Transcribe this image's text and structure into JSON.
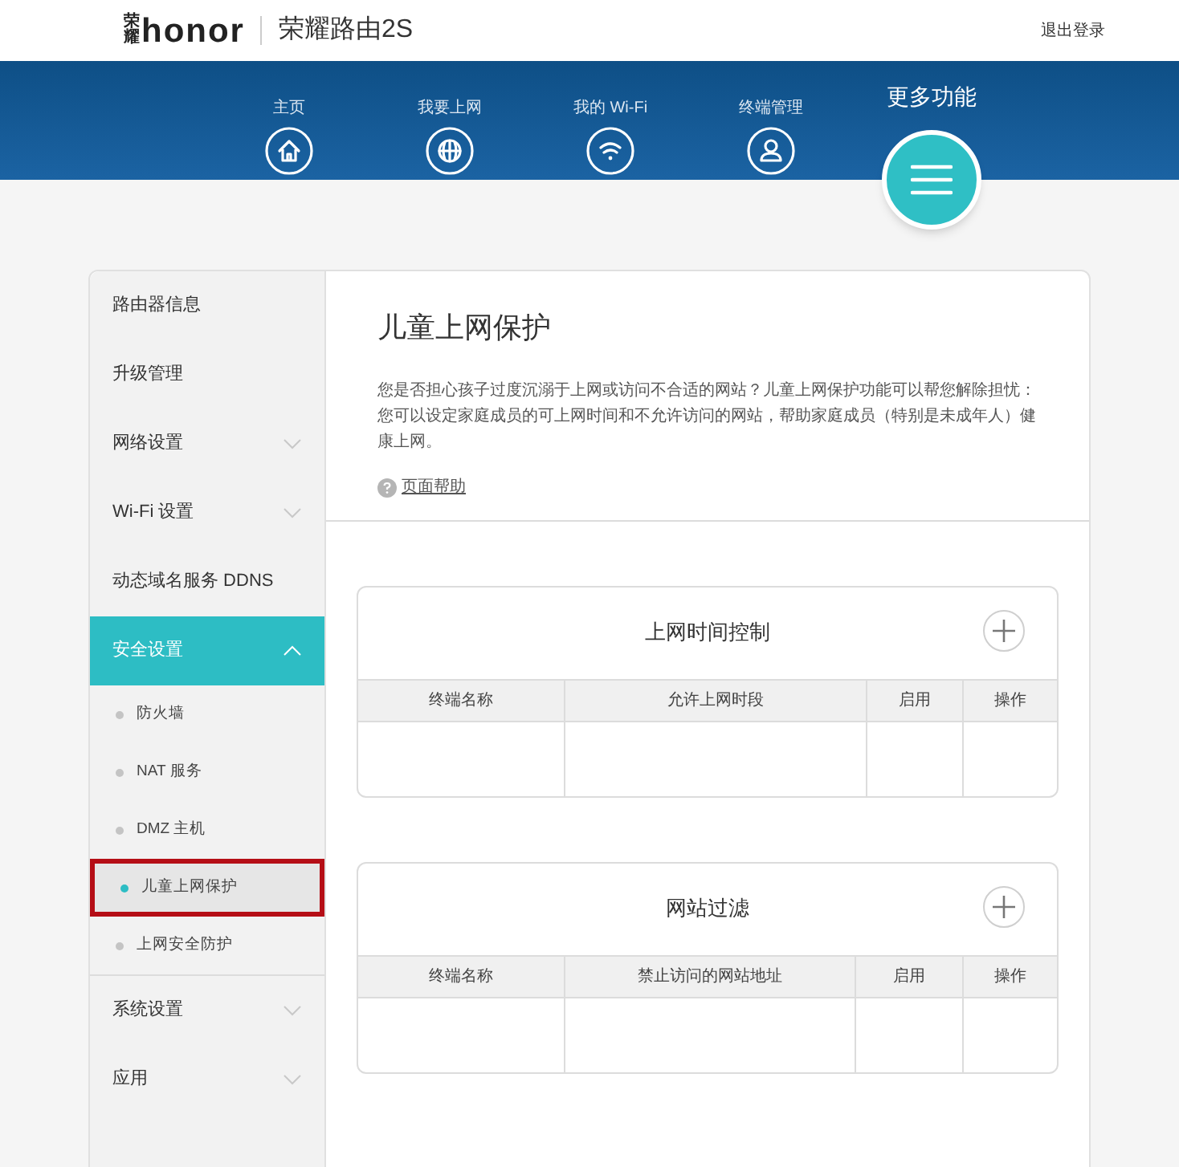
{
  "header": {
    "logo_mark": "荣耀",
    "logo": "honor",
    "product": "荣耀路由2S",
    "logout": "退出登录"
  },
  "nav": [
    {
      "label": "主页",
      "selected": false
    },
    {
      "label": "我要上网",
      "selected": false
    },
    {
      "label": "我的 Wi-Fi",
      "selected": false
    },
    {
      "label": "终端管理",
      "selected": false
    },
    {
      "label": "更多功能",
      "selected": true
    }
  ],
  "sidebar": {
    "items": [
      {
        "kind": "link",
        "label": "路由器信息",
        "selected": false
      },
      {
        "kind": "link",
        "label": "升级管理",
        "selected": false
      },
      {
        "kind": "group",
        "label": "网络设置",
        "selected": false,
        "expanded": false
      },
      {
        "kind": "group",
        "label": "Wi-Fi 设置",
        "selected": false,
        "expanded": false
      },
      {
        "kind": "link",
        "label": "动态域名服务 DDNS",
        "selected": false
      },
      {
        "kind": "group",
        "label": "安全设置",
        "selected": true,
        "expanded": true,
        "children": [
          {
            "label": "防火墙",
            "selected": false
          },
          {
            "label": "NAT 服务",
            "selected": false
          },
          {
            "label": "DMZ 主机",
            "selected": false
          },
          {
            "label": "儿童上网保护",
            "selected": true
          },
          {
            "label": "上网安全防护",
            "selected": false
          }
        ]
      },
      {
        "kind": "group",
        "label": "系统设置",
        "selected": false,
        "expanded": false
      },
      {
        "kind": "group",
        "label": "应用",
        "selected": false,
        "expanded": false
      }
    ]
  },
  "page": {
    "title": "儿童上网保护",
    "description": "您是否担心孩子过度沉溺于上网或访问不合适的网站？儿童上网保护功能可以帮您解除担忧：您可以设定家庭成员的可上网时间和不允许访问的网站，帮助家庭成员（特别是未成年人）健康上网。",
    "help": "页面帮助"
  },
  "tables": [
    {
      "title": "上网时间控制",
      "columns": [
        "终端名称",
        "允许上网时段",
        "启用",
        "操作"
      ]
    },
    {
      "title": "网站过滤",
      "columns": [
        "终端名称",
        "禁止访问的网站地址",
        "启用",
        "操作"
      ]
    }
  ]
}
